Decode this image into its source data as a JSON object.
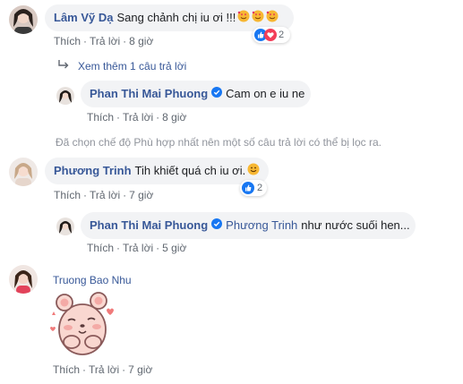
{
  "comments": [
    {
      "author": "Lâm Vỹ Dạ",
      "text": "Sang chảnh chị iu ơi !!! ",
      "like": "Thích",
      "reply": "Trả lời",
      "time": "8 giờ",
      "reaction_count": "2",
      "view_more": "Xem thêm 1 câu trả lời"
    },
    {
      "author": "Phan Thi Mai Phuong",
      "text": "Cam on e iu ne",
      "like": "Thích",
      "reply": "Trả lời",
      "time": "8 giờ"
    },
    {
      "notice": "Đã chọn chế độ Phù hợp nhất nên một số câu trả lời có thể bị lọc ra."
    },
    {
      "author": "Phương Trinh",
      "text": "Tih khiết quá ch iu ơi.",
      "like": "Thích",
      "reply": "Trả lời",
      "time": "7 giờ",
      "reaction_count": "2"
    },
    {
      "author": "Phan Thi Mai Phuong",
      "tag": "Phương Trinh",
      "text": "như nước suối hen...",
      "like": "Thích",
      "reply": "Trả lời",
      "time": "5 giờ"
    },
    {
      "author": "Truong Bao Nhu",
      "like": "Thích",
      "reply": "Trả lời",
      "time": "7 giờ"
    }
  ],
  "colors": {
    "link": "#385898",
    "bubble": "#f2f3f5",
    "meta": "#606770",
    "like_blue": "#1877f2",
    "love_red": "#f33e58",
    "verified": "#1877f2"
  }
}
